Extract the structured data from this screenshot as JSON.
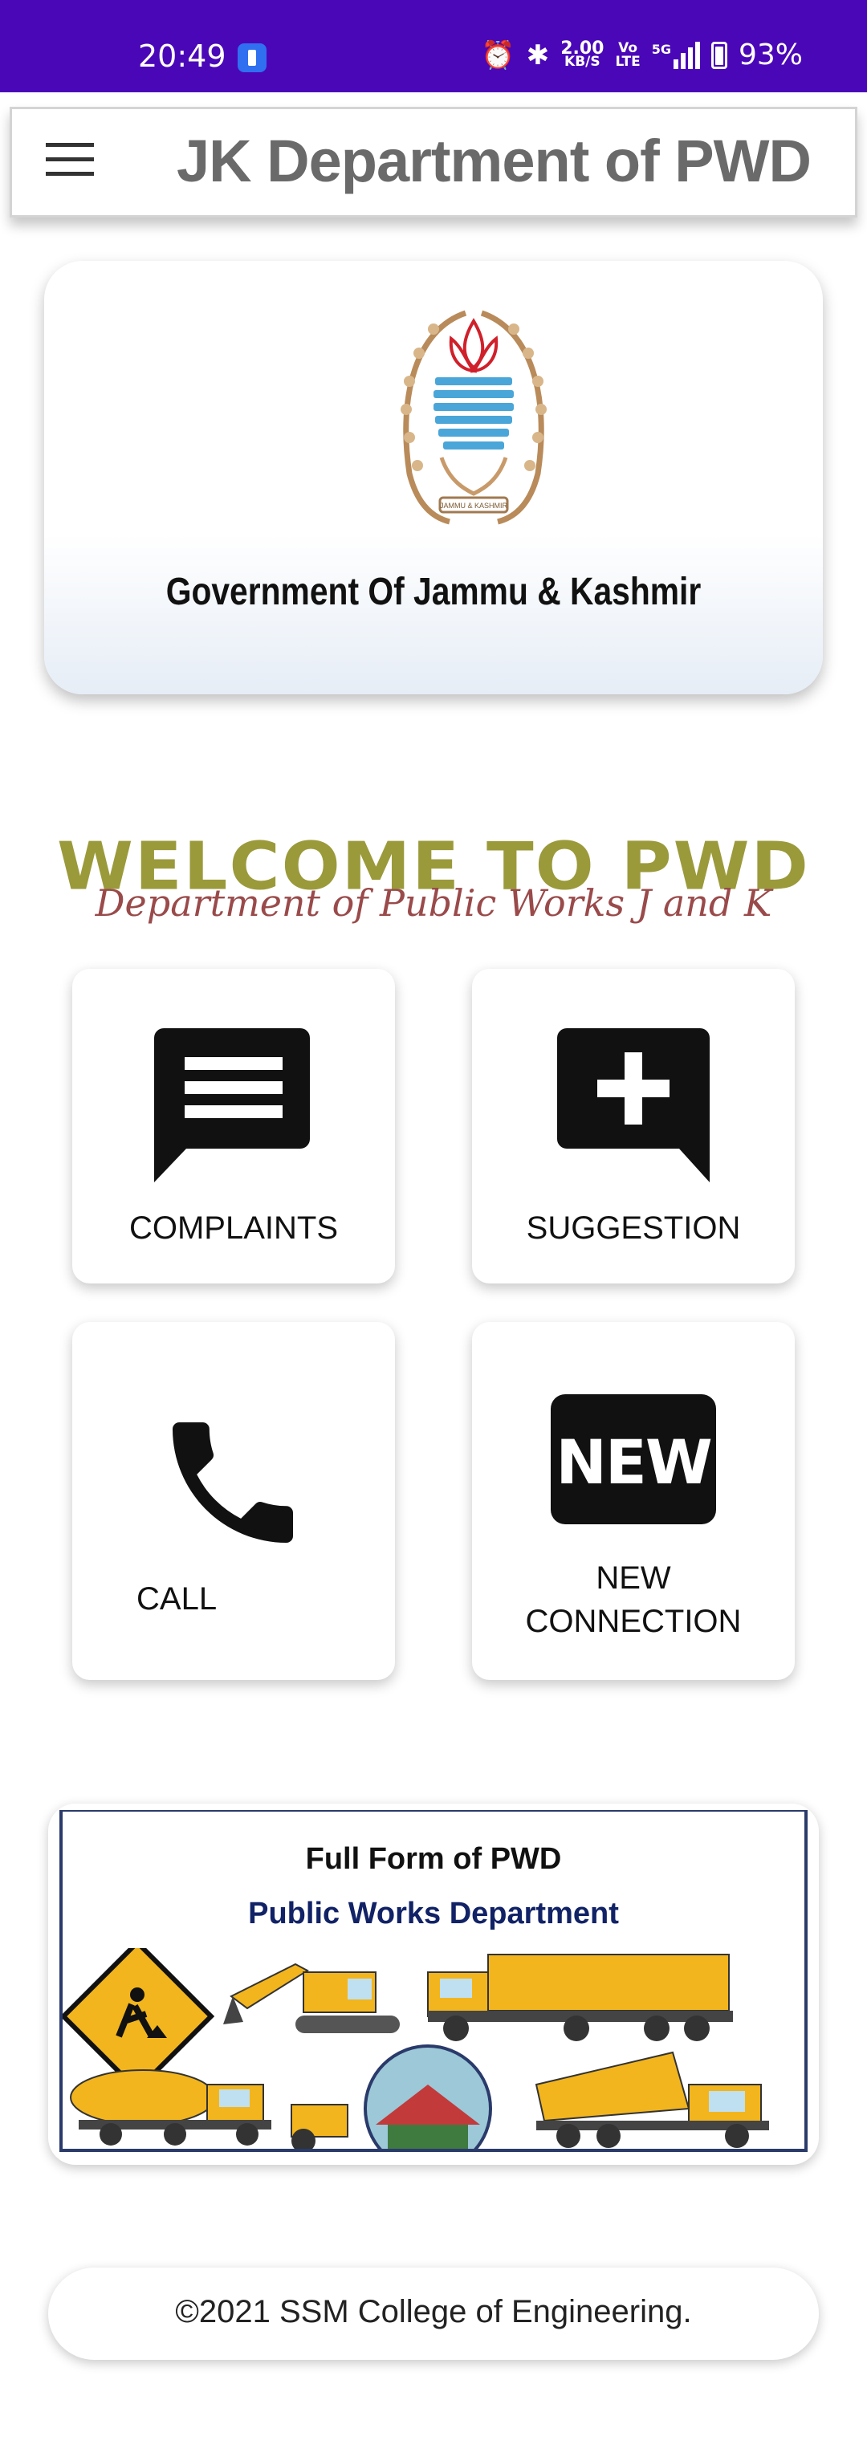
{
  "status_bar": {
    "time": "20:49",
    "speed_value": "2.00",
    "speed_unit": "KB/S",
    "volte_top": "Vo",
    "volte_bottom": "LTE",
    "network": "5G",
    "battery": "93%",
    "icons": [
      "torch-icon",
      "alarm-icon",
      "bluetooth-icon",
      "signal-icon",
      "battery-icon"
    ]
  },
  "app_bar": {
    "title": "JK Department of PWD",
    "menu_icon": "hamburger-menu-icon"
  },
  "banner": {
    "caption": "Government Of Jammu & Kashmir",
    "emblem_text": "JAMMU & KASHMIR"
  },
  "welcome": {
    "title": "WELCOME TO PWD",
    "subtitle": "Department of Public Works J and K"
  },
  "tiles": {
    "complaints": {
      "label": "COMPLAINTS",
      "icon": "comment-list-icon"
    },
    "suggestion": {
      "label": "SUGGESTION",
      "icon": "comment-add-icon"
    },
    "call": {
      "label": "CALL",
      "icon": "phone-icon"
    },
    "new_connection": {
      "label_line1": "NEW",
      "label_line2": "CONNECTION",
      "icon": "new-badge-icon",
      "badge_text": "NEW"
    }
  },
  "pwd_image": {
    "line1": "Full Form of PWD",
    "line2": "Public Works Department"
  },
  "footer": {
    "text": "©2021 SSM College of Engineering."
  },
  "colors": {
    "status_bar": "#4a07b8",
    "title_gray": "#6a6a6a",
    "welcome_olive": "#9b9a3b",
    "welcome_maroon": "#9a4a4a",
    "equipment_yellow": "#f2b51d"
  }
}
